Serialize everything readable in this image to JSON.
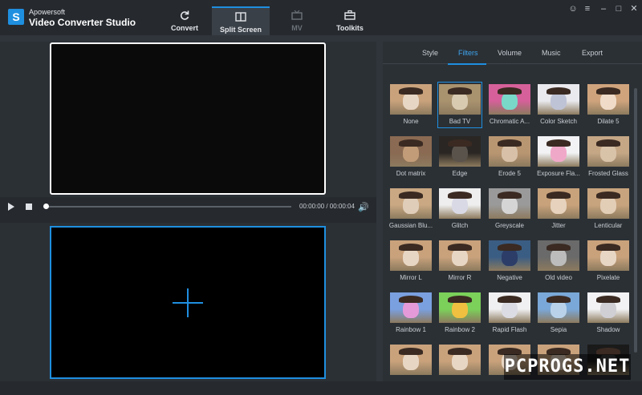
{
  "app": {
    "brand": "Apowersoft",
    "title": "Video Converter Studio"
  },
  "nav": {
    "tabs": [
      {
        "label": "Convert",
        "icon": "refresh-icon"
      },
      {
        "label": "Split Screen",
        "icon": "split-screen-icon"
      },
      {
        "label": "MV",
        "icon": "tv-icon"
      },
      {
        "label": "Toolkits",
        "icon": "toolbox-icon"
      }
    ],
    "active": "Split Screen"
  },
  "player": {
    "time": "00:00:00 / 00:00:04",
    "progress": 0
  },
  "subtabs": {
    "items": [
      "Style",
      "Filters",
      "Volume",
      "Music",
      "Export"
    ],
    "active": "Filters"
  },
  "filters": {
    "selected": "Bad TV",
    "items": [
      {
        "label": "None",
        "tone": "#c9a27c",
        "face": "#e8d6c4"
      },
      {
        "label": "Bad TV",
        "tone": "#a9926e",
        "face": "#d8c9b1"
      },
      {
        "label": "Chromatic A...",
        "tone": "#d6609a",
        "face": "#7ad8c8"
      },
      {
        "label": "Color Sketch",
        "tone": "#e9e9ee",
        "face": "#bfc3d6"
      },
      {
        "label": "Dilate 5",
        "tone": "#cfa47d",
        "face": "#efdbc8"
      },
      {
        "label": "Dot matrix",
        "tone": "#8a6a52",
        "face": "#c29c78"
      },
      {
        "label": "Edge",
        "tone": "#2a2623",
        "face": "#5a534c"
      },
      {
        "label": "Erode 5",
        "tone": "#b99672",
        "face": "#d7c0a7"
      },
      {
        "label": "Exposure Fla...",
        "tone": "#f2f2f4",
        "face": "#f0a8c8"
      },
      {
        "label": "Frosted Glass",
        "tone": "#c5a786",
        "face": "#d8c2a8"
      },
      {
        "label": "Gaussian Blu...",
        "tone": "#c9a883",
        "face": "#dfcdb9"
      },
      {
        "label": "Glitch",
        "tone": "#eeeeee",
        "face": "#d9d9e6"
      },
      {
        "label": "Greyscale",
        "tone": "#9a9a9a",
        "face": "#d5d5d5"
      },
      {
        "label": "Jitter",
        "tone": "#c8a27b",
        "face": "#e6d2bd"
      },
      {
        "label": "Lenticular",
        "tone": "#c7a47e",
        "face": "#e2cdb6"
      },
      {
        "label": "Mirror L",
        "tone": "#c9a27c",
        "face": "#e8d6c4"
      },
      {
        "label": "Mirror R",
        "tone": "#c9a27c",
        "face": "#e8d6c4"
      },
      {
        "label": "Negative",
        "tone": "#3a5d83",
        "face": "#2c3d68"
      },
      {
        "label": "Old video",
        "tone": "#6a6a6a",
        "face": "#bcbcbc"
      },
      {
        "label": "Pixelate",
        "tone": "#c9a27c",
        "face": "#e8d6c4"
      },
      {
        "label": "Rainbow 1",
        "tone": "#7aa0e0",
        "face": "#e49ad8"
      },
      {
        "label": "Rainbow 2",
        "tone": "#7bd15a",
        "face": "#f0c040"
      },
      {
        "label": "Rapid Flash",
        "tone": "#f0f0f2",
        "face": "#dcdce4"
      },
      {
        "label": "Sepia",
        "tone": "#7aa8d8",
        "face": "#b9d2ea"
      },
      {
        "label": "Shadow",
        "tone": "#f2f2f4",
        "face": "#cfcfd4"
      },
      {
        "label": "",
        "tone": "#c9a27c",
        "face": "#e8d6c4"
      },
      {
        "label": "",
        "tone": "#c9a27c",
        "face": "#e8d6c4"
      },
      {
        "label": "",
        "tone": "#c9a27c",
        "face": "#e8d6c4"
      },
      {
        "label": "",
        "tone": "#c9a27c",
        "face": "#e8d6c4"
      },
      {
        "label": "",
        "tone": "#1a1a1a",
        "face": "#3a3a3a"
      }
    ]
  },
  "watermark": "PCPROGS.NET",
  "colors": {
    "accent": "#1f8fe0",
    "background": "#30353b"
  }
}
